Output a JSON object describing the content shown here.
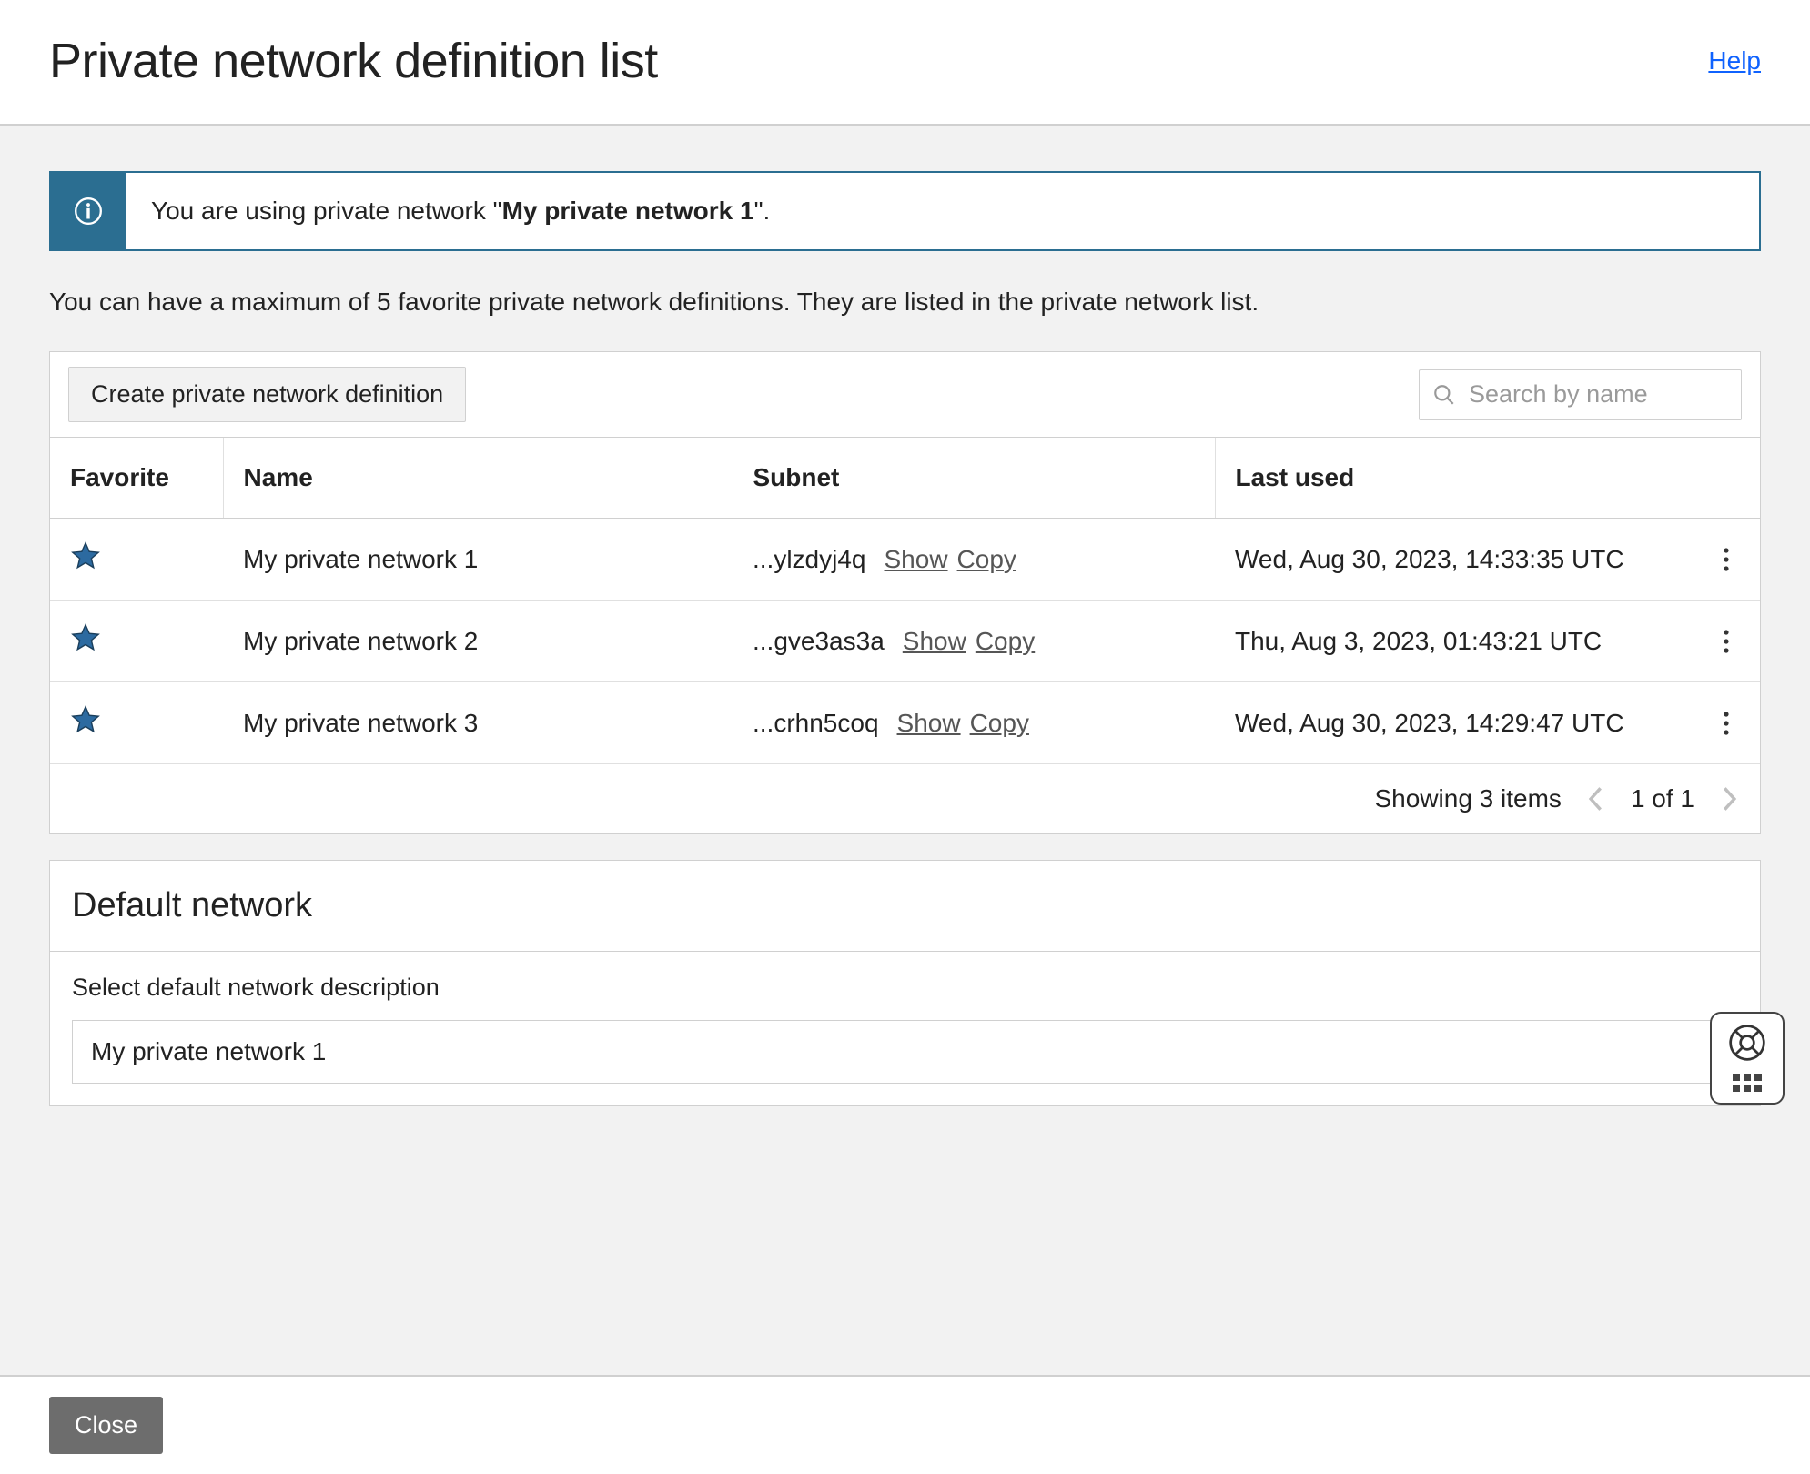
{
  "header": {
    "title": "Private network definition list",
    "help_label": "Help"
  },
  "info_banner": {
    "prefix": "You are using private network \"",
    "network_name": "My private network 1",
    "suffix": "\"."
  },
  "limit_text": "You can have a maximum of 5 favorite private network definitions. They are listed in the private network list.",
  "toolbar": {
    "create_label": "Create private network definition",
    "search_placeholder": "Search by name"
  },
  "table": {
    "columns": {
      "favorite": "Favorite",
      "name": "Name",
      "subnet": "Subnet",
      "last_used": "Last used"
    },
    "actions": {
      "show": "Show",
      "copy": "Copy"
    },
    "rows": [
      {
        "favorite": true,
        "name": "My private network 1",
        "subnet_fragment": "...ylzdyj4q",
        "last_used": "Wed, Aug 30, 2023, 14:33:35 UTC"
      },
      {
        "favorite": true,
        "name": "My private network 2",
        "subnet_fragment": "...gve3as3a",
        "last_used": "Thu, Aug 3, 2023, 01:43:21 UTC"
      },
      {
        "favorite": true,
        "name": "My private network 3",
        "subnet_fragment": "...crhn5coq",
        "last_used": "Wed, Aug 30, 2023, 14:29:47 UTC"
      }
    ]
  },
  "pagination": {
    "showing_label": "Showing 3 items",
    "page_of": "1 of 1"
  },
  "default_network": {
    "section_title": "Default network",
    "select_label": "Select default network description",
    "selected_value": "My private network 1"
  },
  "footer": {
    "close_label": "Close"
  }
}
